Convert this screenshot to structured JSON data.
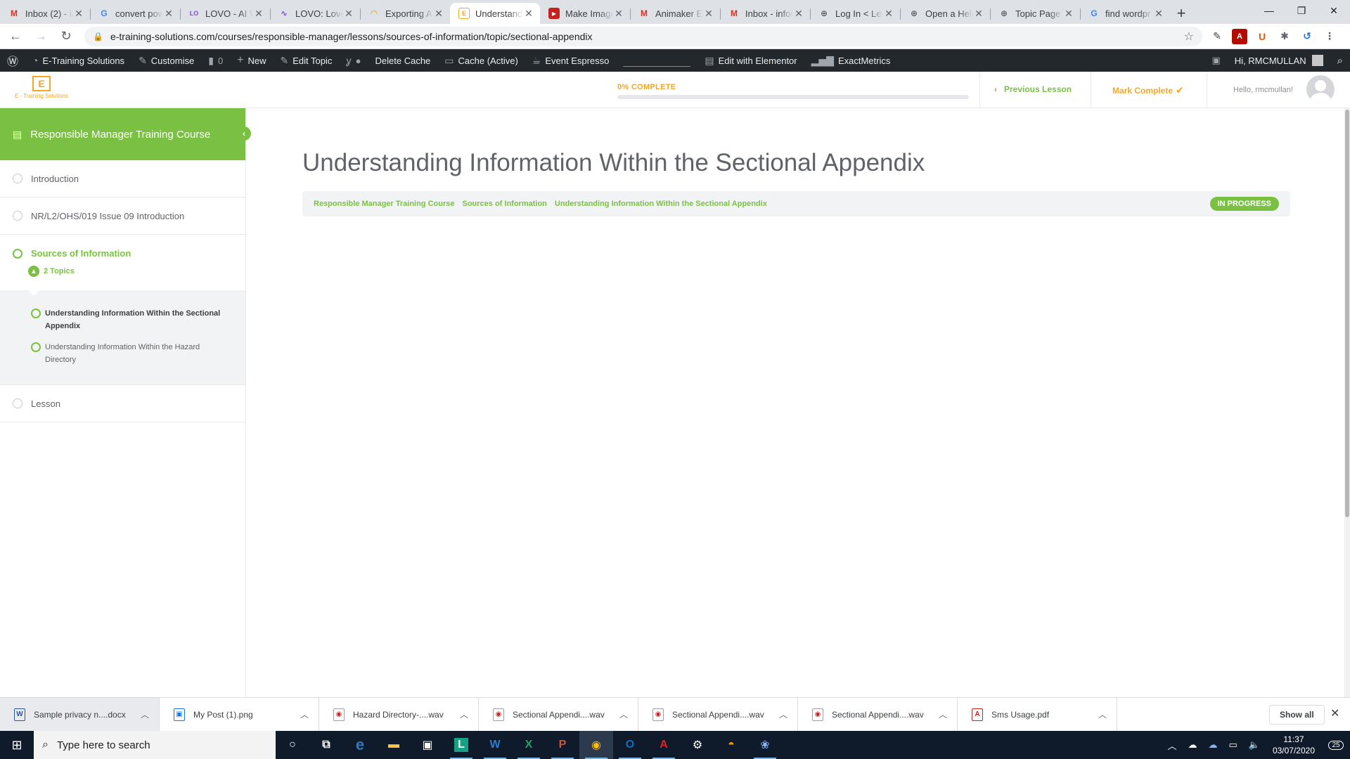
{
  "browser": {
    "tabs": [
      {
        "title": "Inbox (2) - in",
        "favicon": "gmail-icon",
        "color": "#d93025"
      },
      {
        "title": "convert pow",
        "favicon": "google-icon",
        "color": "#4285f4"
      },
      {
        "title": "LOVO - AI V",
        "favicon": "lovo-icon",
        "color": "#7b4de0"
      },
      {
        "title": "LOVO: Love",
        "favicon": "lovo-wave-icon",
        "color": "#7b4de0"
      },
      {
        "title": "Exporting A",
        "favicon": "audacity-icon",
        "color": "#f29900"
      },
      {
        "title": "Understandi",
        "favicon": "etraining-icon",
        "color": "#f5a623"
      },
      {
        "title": "Make Image",
        "favicon": "video-icon",
        "color": "#c5221f"
      },
      {
        "title": "Animaker En",
        "favicon": "gmail-icon",
        "color": "#d93025"
      },
      {
        "title": "Inbox - infor",
        "favicon": "gmail-icon",
        "color": "#d93025"
      },
      {
        "title": "Log In < Lea",
        "favicon": "globe-icon",
        "color": "#5f6368"
      },
      {
        "title": "Open a Help",
        "favicon": "globe-icon",
        "color": "#5f6368"
      },
      {
        "title": "Topic Page C",
        "favicon": "globe-icon",
        "color": "#5f6368"
      },
      {
        "title": "find wordpr",
        "favicon": "google-icon",
        "color": "#4285f4"
      }
    ],
    "active_tab": 5,
    "url": "e-training-solutions.com/courses/responsible-manager/lessons/sources-of-information/topic/sectional-appendix"
  },
  "adminbar": {
    "site_name": "E-Training Solutions",
    "customise": "Customise",
    "comments_count": "0",
    "new": "New",
    "edit_topic": "Edit Topic",
    "delete_cache": "Delete Cache",
    "cache_status": "Cache (Active)",
    "event_espresso": "Event Espresso",
    "edit_elementor": "Edit with Elementor",
    "exactmetrics": "ExactMetrics",
    "greeting": "Hi, RMCMULLAN"
  },
  "header": {
    "logo_letter": "E",
    "logo_text": "E - Training Solutions",
    "progress_label": "0% COMPLETE",
    "progress_fraction": 0,
    "prev_lesson": "Previous Lesson",
    "mark_complete": "Mark Complete",
    "hello": "Hello, rmcmullan!"
  },
  "sidebar": {
    "course_title": "Responsible Manager Training Course",
    "lessons": [
      {
        "label": "Introduction"
      },
      {
        "label": "NR/L2/OHS/019 Issue 09 Introduction"
      },
      {
        "label": "Sources of Information",
        "topics_count": "2 Topics"
      },
      {
        "label": "Lesson"
      }
    ],
    "topics": [
      {
        "label": "Understanding Information Within the Sectional Appendix"
      },
      {
        "label": "Understanding Information Within the Hazard Directory"
      }
    ]
  },
  "main": {
    "title": "Understanding Information Within the Sectional Appendix",
    "breadcrumbs": [
      "Responsible Manager Training Course",
      "Sources of Information",
      "Understanding Information Within the Sectional Appendix"
    ],
    "status": "IN PROGRESS"
  },
  "downloads": {
    "items": [
      {
        "name": "Sample privacy n....docx",
        "icon": "W"
      },
      {
        "name": "My Post (1).png",
        "icon": "▣"
      },
      {
        "name": "Hazard Directory-....wav",
        "icon": "◉"
      },
      {
        "name": "Sectional Appendi....wav",
        "icon": "◉"
      },
      {
        "name": "Sectional Appendi....wav",
        "icon": "◉"
      },
      {
        "name": "Sectional Appendi....wav",
        "icon": "◉"
      },
      {
        "name": "Sms Usage.pdf",
        "icon": "A"
      }
    ],
    "show_all": "Show all"
  },
  "taskbar": {
    "search_placeholder": "Type here to search",
    "time": "11:37",
    "date": "03/07/2020",
    "notification_count": "25"
  },
  "colors": {
    "accent_green": "#7ac143",
    "accent_orange": "#f5a623",
    "adminbar": "#23282d"
  }
}
